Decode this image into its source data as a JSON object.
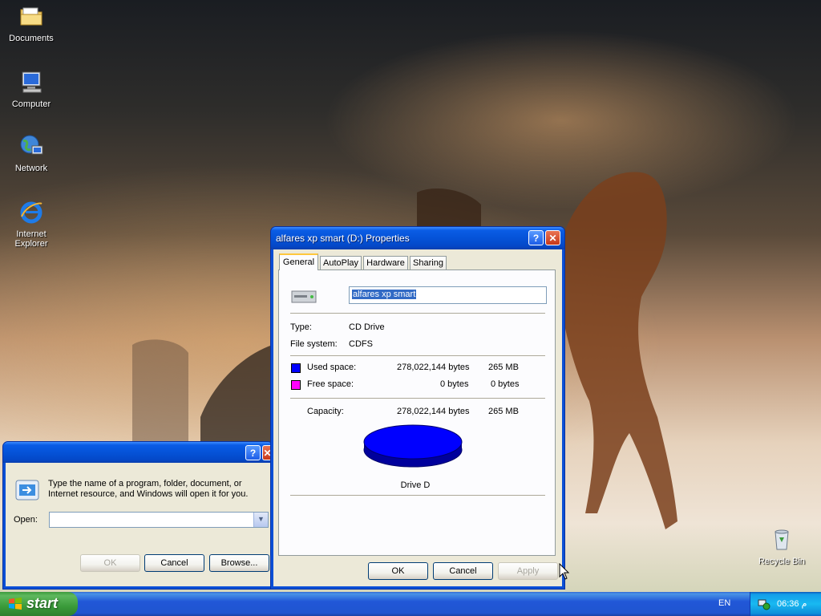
{
  "desktop": {
    "icons": [
      {
        "label": "Documents",
        "icon": "folder-icon"
      },
      {
        "label": "Computer",
        "icon": "computer-icon"
      },
      {
        "label": "Network",
        "icon": "network-icon"
      },
      {
        "label": "Internet Explorer",
        "icon": "internet-explorer-icon"
      },
      {
        "label": "Recycle Bin",
        "icon": "recycle-bin-icon"
      }
    ]
  },
  "properties_dialog": {
    "title": "alfares xp smart (D:) Properties",
    "tabs": [
      "General",
      "AutoPlay",
      "Hardware",
      "Sharing"
    ],
    "active_tab": "General",
    "label_value": "alfares xp smart",
    "type_label": "Type:",
    "type_value": "CD Drive",
    "fs_label": "File system:",
    "fs_value": "CDFS",
    "used_label": "Used space:",
    "used_bytes": "278,022,144 bytes",
    "used_mb": "265 MB",
    "free_label": "Free space:",
    "free_bytes": "0 bytes",
    "free_mb": "0 bytes",
    "capacity_label": "Capacity:",
    "capacity_bytes": "278,022,144 bytes",
    "capacity_mb": "265 MB",
    "drive_label": "Drive D",
    "used_fraction": 1.0,
    "colors": {
      "used": "#0000ff",
      "free": "#ff00ff"
    },
    "buttons": {
      "ok": "OK",
      "cancel": "Cancel",
      "apply": "Apply"
    }
  },
  "run_dialog": {
    "description": "Type the name of a program, folder, document, or Internet resource, and Windows will open it for you.",
    "open_label": "Open:",
    "open_value": "",
    "buttons": {
      "ok": "OK",
      "cancel": "Cancel",
      "browse": "Browse..."
    }
  },
  "taskbar": {
    "start_label": "start",
    "language": "EN",
    "clock": "06:36 م"
  }
}
